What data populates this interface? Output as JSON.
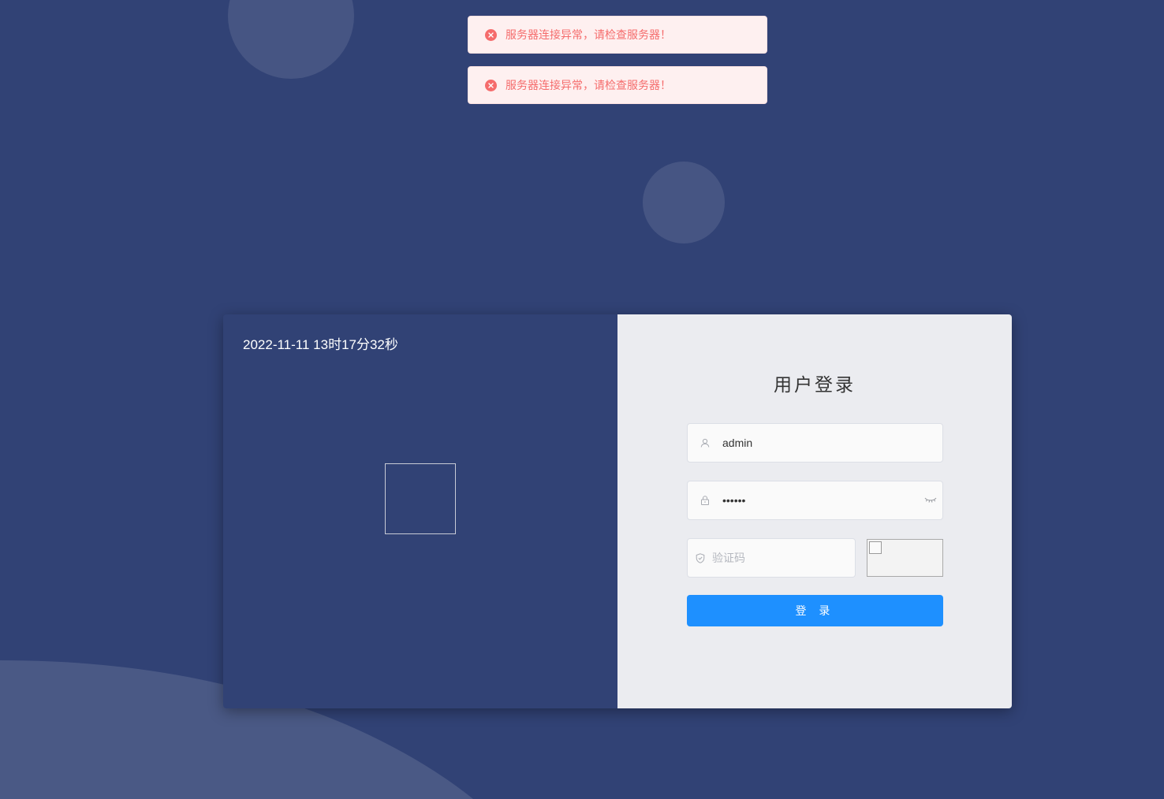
{
  "toasts": [
    {
      "icon": "error-circle-icon",
      "message": "服务器连接异常，请检查服务器！"
    },
    {
      "icon": "error-circle-icon",
      "message": "服务器连接异常，请检查服务器！"
    }
  ],
  "left_panel": {
    "datetime": "2022-11-11 13时17分32秒"
  },
  "login_form": {
    "title": "用户登录",
    "username": {
      "value": "admin",
      "icon": "user-icon"
    },
    "password": {
      "value": "••••••",
      "icon": "lock-icon",
      "toggle_icon": "eye-closed-icon"
    },
    "captcha": {
      "placeholder": "验证码",
      "value": "",
      "icon": "shield-icon"
    },
    "submit_label": "登 录"
  },
  "colors": {
    "background": "#314275",
    "card_right": "#ebecf0",
    "primary": "#1e90ff",
    "error": "#f56c6c",
    "error_bg": "#fef0f0"
  }
}
